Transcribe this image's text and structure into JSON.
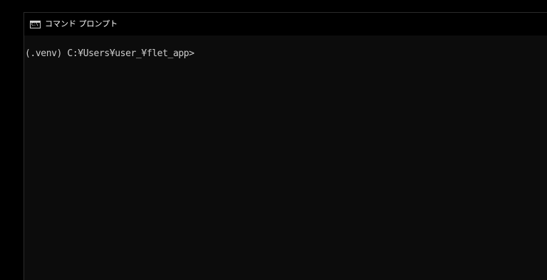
{
  "window": {
    "title": "コマンド プロンプト",
    "icon": "console-app-icon",
    "icon_text": "C:\\"
  },
  "console": {
    "lines": [
      "(.venv) C:¥Users¥user_¥flet_app>"
    ]
  },
  "colors": {
    "background": "#0c0c0c",
    "titlebar": "#000000",
    "text": "#cccccc",
    "title_text": "#ffffff"
  }
}
